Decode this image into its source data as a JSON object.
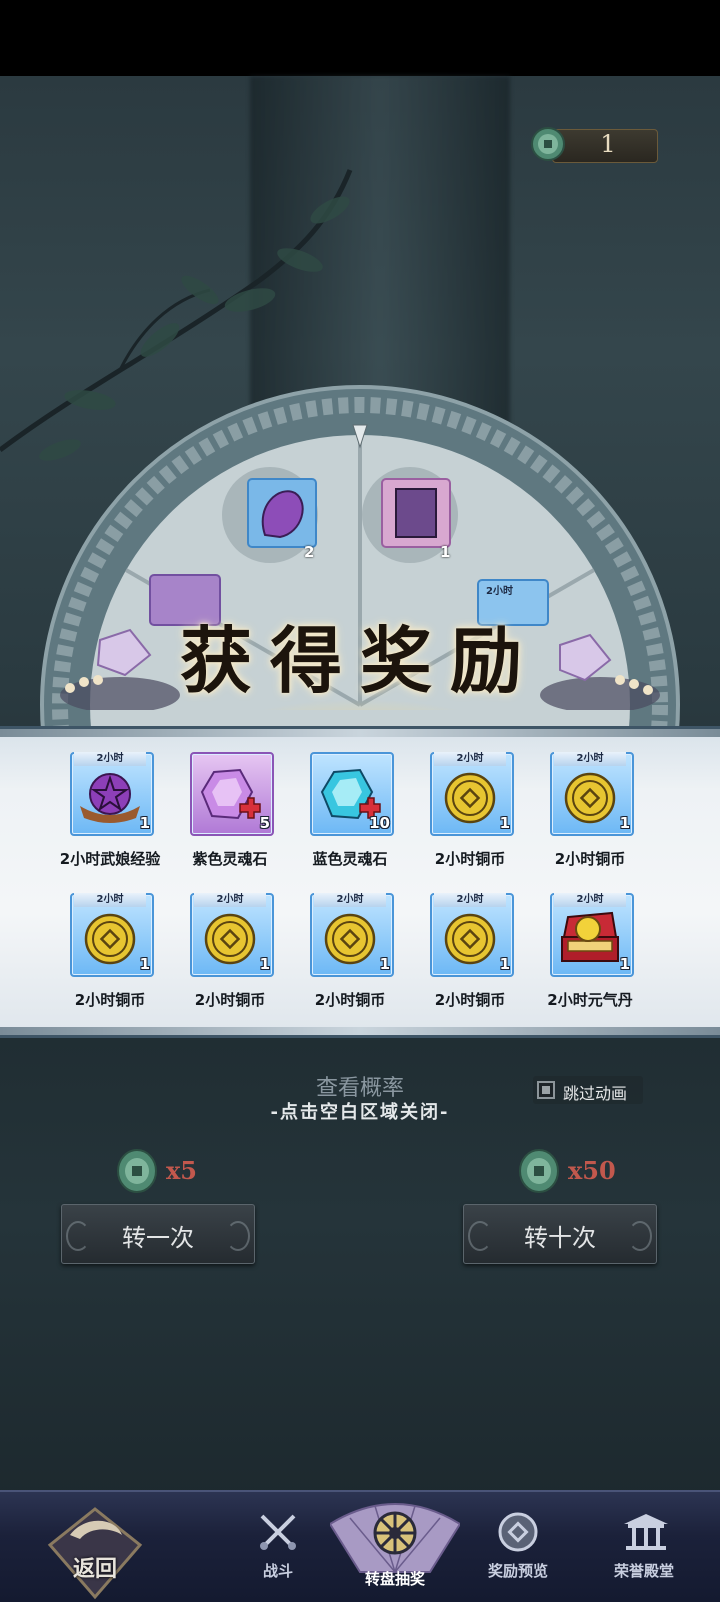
{
  "currency": {
    "value": "1",
    "icon": "jade-coin-icon"
  },
  "title": "获得奖励",
  "wheel_items": [
    {
      "icon": "purple-seed-icon",
      "count": "2"
    },
    {
      "icon": "sect-card-icon",
      "count": "1"
    },
    {
      "icon": "purple-gem-icon"
    },
    {
      "icon": "copper-coin-icon",
      "tag": "2小时"
    }
  ],
  "rewards": [
    {
      "name": "2小时武娘经验",
      "count": "1",
      "tag": "2小时",
      "icon": "exp-scroll-icon",
      "frame": "blue"
    },
    {
      "name": "紫色灵魂石",
      "count": "5",
      "tag": "",
      "icon": "purple-soulstone-icon",
      "frame": "purple"
    },
    {
      "name": "蓝色灵魂石",
      "count": "10",
      "tag": "",
      "icon": "blue-soulstone-icon",
      "frame": "blue"
    },
    {
      "name": "2小时铜币",
      "count": "1",
      "tag": "2小时",
      "icon": "copper-coin-icon",
      "frame": "blue"
    },
    {
      "name": "2小时铜币",
      "count": "1",
      "tag": "2小时",
      "icon": "copper-coin-icon",
      "frame": "blue"
    },
    {
      "name": "2小时铜币",
      "count": "1",
      "tag": "2小时",
      "icon": "copper-coin-icon",
      "frame": "blue"
    },
    {
      "name": "2小时铜币",
      "count": "1",
      "tag": "2小时",
      "icon": "copper-coin-icon",
      "frame": "blue"
    },
    {
      "name": "2小时铜币",
      "count": "1",
      "tag": "2小时",
      "icon": "copper-coin-icon",
      "frame": "blue"
    },
    {
      "name": "2小时铜币",
      "count": "1",
      "tag": "2小时",
      "icon": "copper-coin-icon",
      "frame": "blue"
    },
    {
      "name": "2小时元气丹",
      "count": "1",
      "tag": "2小时",
      "icon": "vitality-pill-box-icon",
      "frame": "blue"
    }
  ],
  "probability_label": "查看概率",
  "close_hint": "-点击空白区域关闭-",
  "skip_animation": {
    "label": "跳过动画",
    "checked": false
  },
  "spin_once": {
    "cost": "x5",
    "label": "转一次"
  },
  "spin_ten": {
    "cost": "x50",
    "label": "转十次"
  },
  "nav": {
    "back": "返回",
    "items": [
      {
        "label": "战斗",
        "icon": "crossed-swords-icon"
      },
      {
        "label": "转盘抽奖",
        "icon": "wheel-icon",
        "active": true
      },
      {
        "label": "奖励预览",
        "icon": "coin-preview-icon"
      },
      {
        "label": "荣誉殿堂",
        "icon": "hall-icon"
      }
    ]
  },
  "colors": {
    "accent_red": "#c2584d",
    "panel_border": "#3e5566",
    "coin_gold": "#e7c531",
    "frame_blue": "#4a95d8",
    "frame_purple": "#8a55b6"
  }
}
